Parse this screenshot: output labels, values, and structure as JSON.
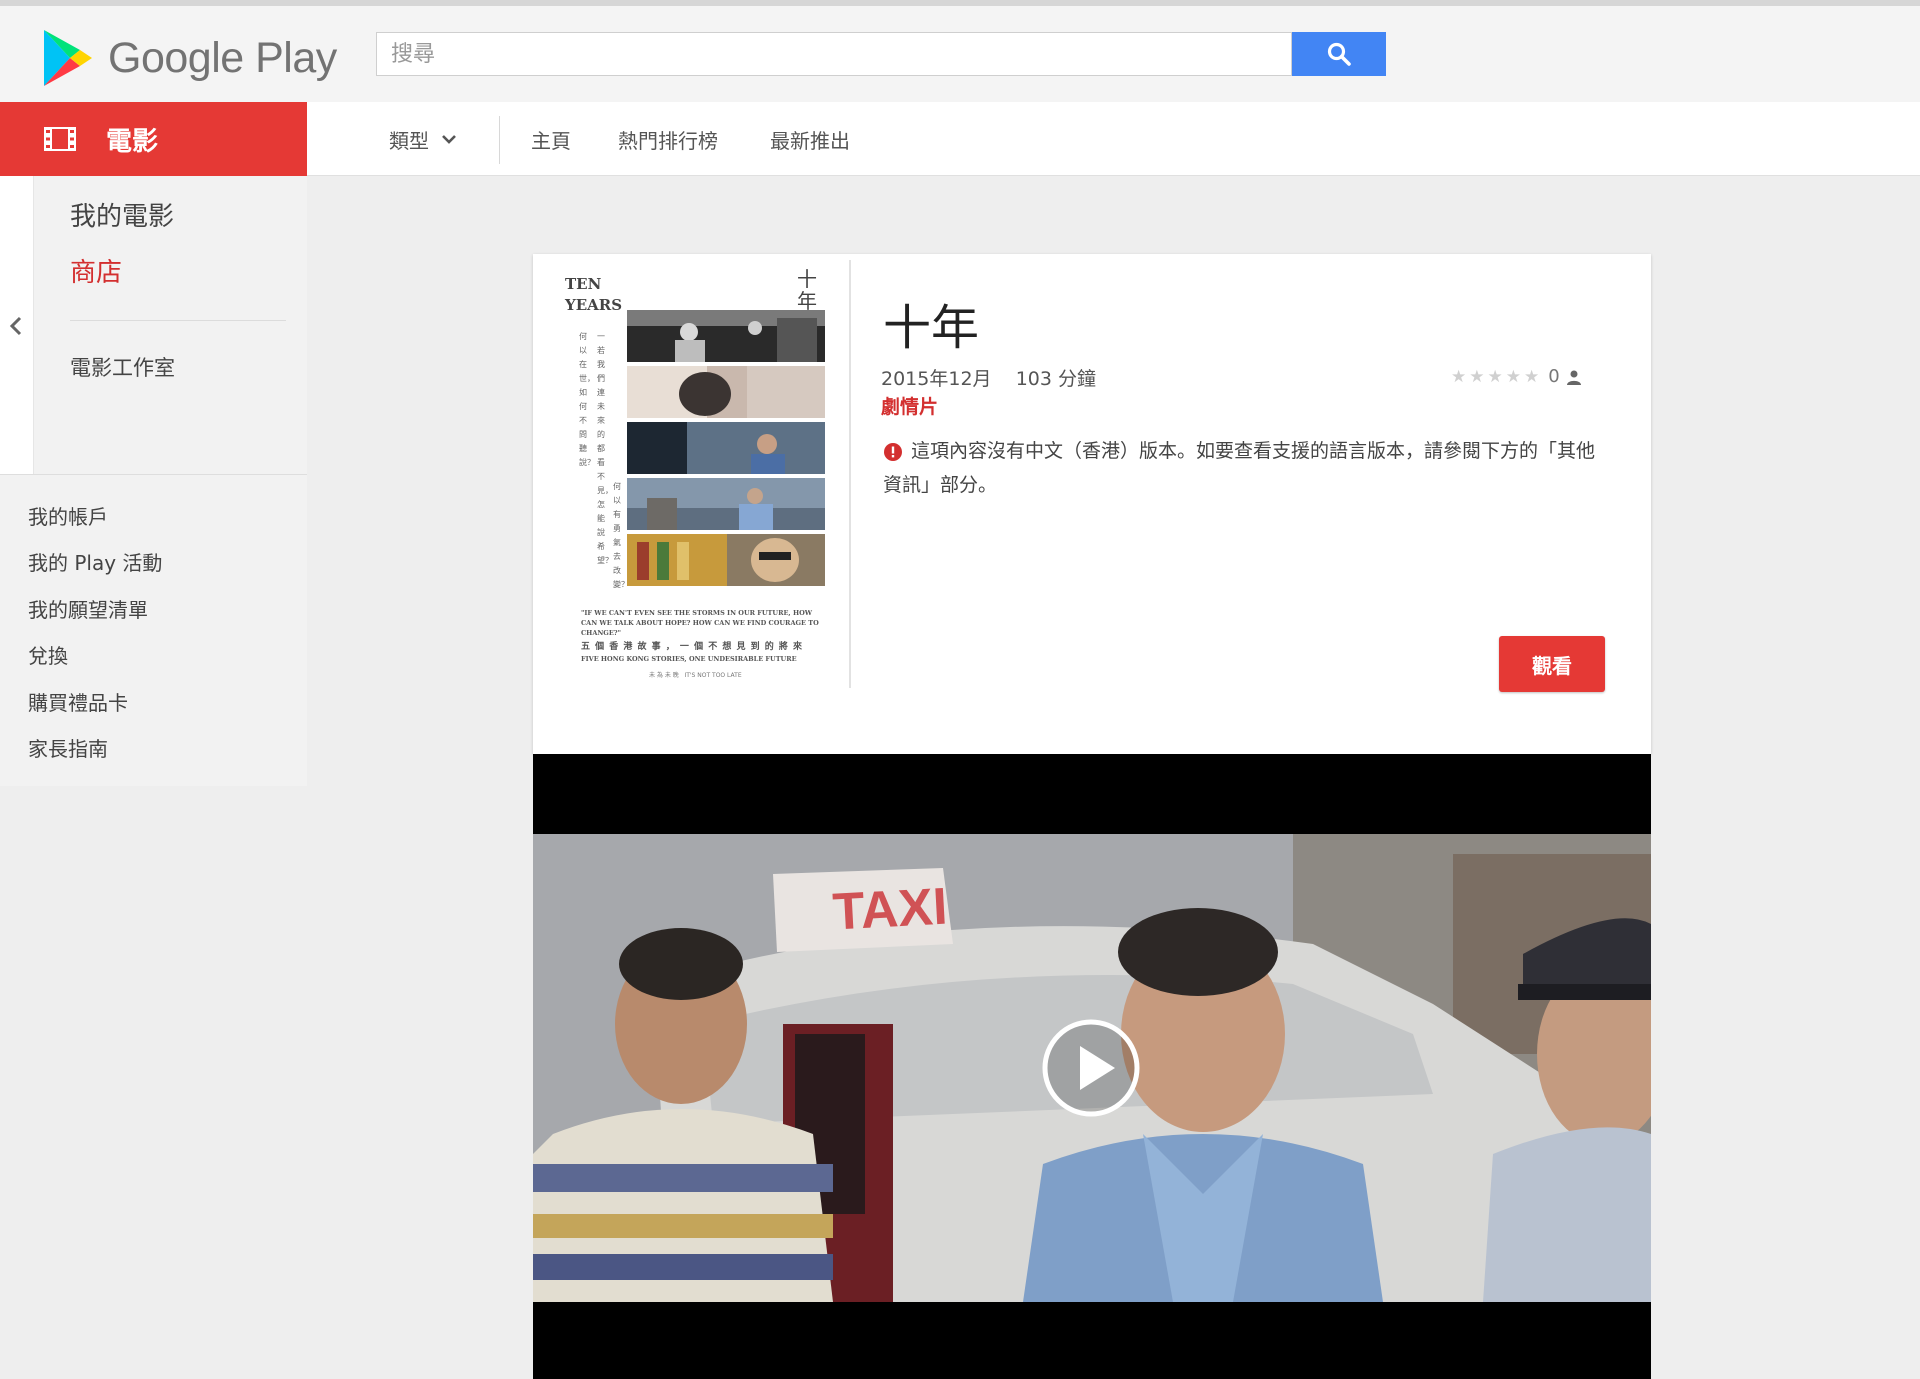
{
  "header": {
    "brand": "Google Play",
    "search_placeholder": "搜尋"
  },
  "sidebar": {
    "category": "電影",
    "my_movies": "我的電影",
    "store": "商店",
    "studio": "電影工作室",
    "account_links": [
      "我的帳戶",
      "我的 Play 活動",
      "我的願望清單",
      "兌換",
      "購買禮品卡",
      "家長指南"
    ]
  },
  "tabs": {
    "genre": "類型",
    "home": "主頁",
    "top_charts": "熱門排行榜",
    "new_releases": "最新推出"
  },
  "movie": {
    "title": "十年",
    "meta": "2015年12月    103 分鐘",
    "genre": "劇情片",
    "rating_count": "0",
    "rating_stars": 0,
    "notice": "這項內容沒有中文（香港）版本。如要查看支援的語言版本，請參閱下方的「其他資訊」部分。",
    "watch_label": "觀看"
  },
  "poster": {
    "title_en_1": "TEN",
    "title_en_2": "YEARS",
    "title_cjk": "十年",
    "col_1": "何以在世，如何不問聽說？",
    "col_2": "一若我們連未來的都看不見，怎能說希望？",
    "col_3": "何以有勇氣去改變？",
    "quote": "\"IF WE CAN'T EVEN SEE THE STORMS IN OUR FUTURE, HOW CAN WE TALK ABOUT HOPE? HOW CAN WE FIND COURAGE TO CHANGE?\"",
    "tagline_zh": "五 個 香 港 故 事 ， 一 個 不 想 見 到 的 將 來",
    "tagline_en": "FIVE HONG KONG STORIES, ONE UNDESIRABLE FUTURE",
    "footer": "未 為 未 晚   IT'S NOT TOO LATE"
  },
  "trailer": {
    "taxi_sign": "TAXI"
  },
  "colors": {
    "accent_red": "#e53935",
    "search_blue": "#4285f4"
  }
}
